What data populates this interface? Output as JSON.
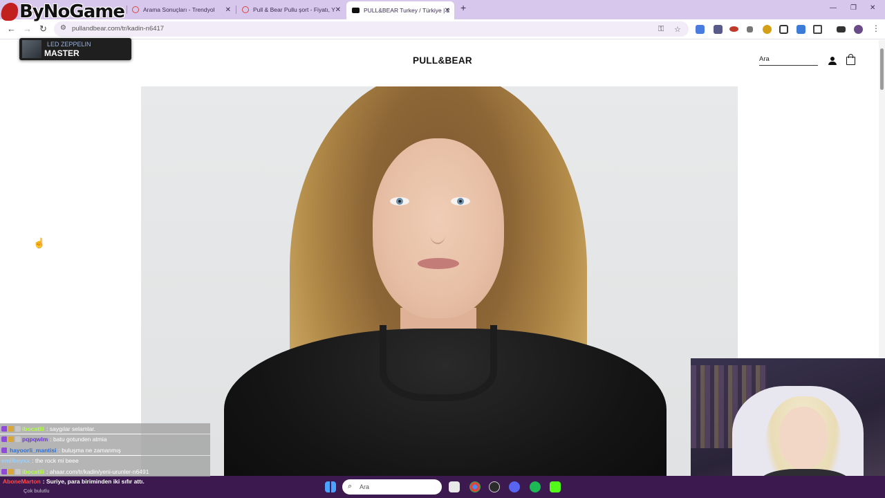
{
  "browser": {
    "tabs": [
      {
        "title": "",
        "favicon": "trendyol"
      },
      {
        "title": "Arama Sonuçları - Trendyol",
        "favicon": "trendyol"
      },
      {
        "title": "Pull & Bear Pullu şort - Fiyatı, Y",
        "favicon": "trendyol"
      },
      {
        "title": "PULL&BEAR Turkey / Türkiye | 2",
        "favicon": "pullandbear",
        "active": true
      }
    ],
    "new_tab": "+",
    "url": "pullandbear.com/tr/kadin-n6417"
  },
  "overlay": {
    "channel_logo": "ByNoGame",
    "now_playing": {
      "artist": "LED ZEPPELIN",
      "title": "MASTER"
    }
  },
  "site": {
    "brand": "PULL&BEAR",
    "search_value": "Ara",
    "icons": [
      "user-icon",
      "bag-icon"
    ]
  },
  "chat": {
    "messages": [
      {
        "user": "ibocatlii",
        "text": ": saygılar selamlar.",
        "user_color": "#b6ff4d"
      },
      {
        "user": "pqpqwlm",
        "text": ": batu gotunden atmia",
        "user_color": "#6a39c9"
      },
      {
        "user": "hayoorli_mantisi",
        "text": ": buluşma ne zamanmış",
        "user_color": "#2f6fd6"
      },
      {
        "user": "emilbeyxx",
        "text": ": the rock mi beee",
        "user_color": "#9ad1ff"
      },
      {
        "user": "ibocatlii",
        "text": ": ahaar.com/tr/kadin/yeni-urunler-n6491",
        "user_color": "#b6ff4d"
      }
    ],
    "notification": {
      "user": "AboneMarton",
      "text": ": Suriye, para biriminden iki sıfır attı.",
      "subtext": "Çok bulutlu"
    }
  },
  "taskbar": {
    "search_placeholder": "Ara",
    "apps": [
      "start",
      "file-explorer",
      "chrome",
      "obs",
      "discord",
      "spotify",
      "live"
    ]
  },
  "colors": {
    "tabbar": "#d8c7ec",
    "taskbar": "#3c1a4f",
    "accent_red": "#c21f1f"
  }
}
